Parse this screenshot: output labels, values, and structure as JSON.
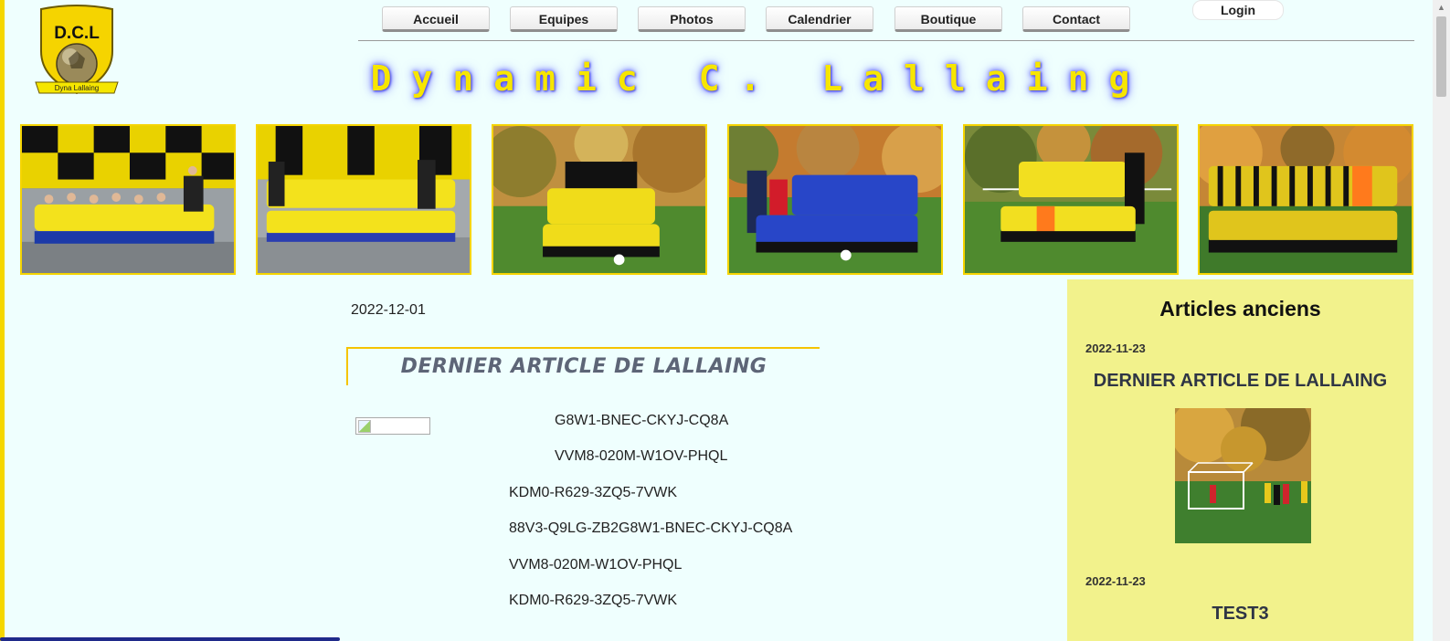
{
  "logo": {
    "letters": "D.C.L",
    "banner": "Dyna Lallaing"
  },
  "nav": {
    "items": [
      "Accueil",
      "Equipes",
      "Photos",
      "Calendrier",
      "Boutique",
      "Contact"
    ],
    "login": "Login"
  },
  "site": {
    "title": "Dynamic C. Lallaing"
  },
  "colors": {
    "accent": "#f5d700",
    "background": "#effffe",
    "sidebar": "#f2f28c",
    "title_glow": "#4b4bff"
  },
  "article": {
    "date": "2022-12-01",
    "title": "DERNIER ARTICLE DE LALLAING",
    "lines": [
      "G8W1-BNEC-CKYJ-CQ8A",
      "VVM8-020M-W1OV-PHQL",
      "KDM0-R629-3ZQ5-7VWK",
      "88V3-Q9LG-ZB2G8W1-BNEC-CKYJ-CQ8A",
      "VVM8-020M-W1OV-PHQL",
      "KDM0-R629-3ZQ5-7VWK"
    ]
  },
  "sidebar": {
    "title": "Articles anciens",
    "articles": [
      {
        "date": "2022-11-23",
        "title": "DERNIER ARTICLE DE LALLAING"
      },
      {
        "date": "2022-11-23",
        "title": "TEST3"
      }
    ]
  }
}
